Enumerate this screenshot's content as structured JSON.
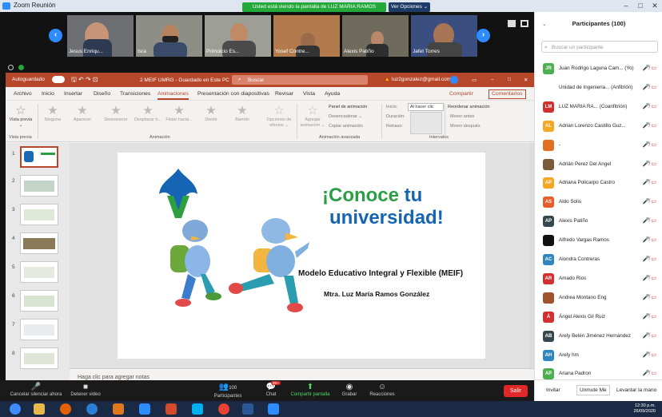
{
  "window": {
    "title": "Zoom Reunión"
  },
  "banner": {
    "share_text": "Usted está viendo la pantalla de LUZ MARIA RAMOS",
    "view_options": "Ver Opciones ⌄"
  },
  "video_tiles": [
    {
      "name": "Jesus Enriqu..."
    },
    {
      "name": "Isra"
    },
    {
      "name": "Primoicio Es..."
    },
    {
      "name": "Yosef Contre..."
    },
    {
      "name": "Alexis Patiño"
    },
    {
      "name": "Jafet Torres"
    }
  ],
  "ppt": {
    "autosave": "Autoguardado",
    "file": "2 MEIF UMRG - Guardado en Este PC ⌄",
    "search": "Buscar",
    "user": "luz2gonzalez@gmail.com",
    "tabs": [
      "Archivo",
      "Inicio",
      "Insertar",
      "Diseño",
      "Transiciones",
      "Animaciones",
      "Presentación con diapositivas",
      "Revisar",
      "Vista",
      "Ayuda"
    ],
    "active_tab": "Animaciones",
    "share": "Compartir",
    "comments": "Comentarios",
    "ribbon": {
      "vista_previa": "Vista previa ⌄",
      "vista_group": "Vista previa",
      "effects": [
        "Ninguna",
        "Aparecer",
        "Desvanecer",
        "Desplazar h...",
        "Flotar hacia...",
        "Dividir",
        "Barrido"
      ],
      "effect_options": "Opciones de efectos ⌄",
      "animation_group": "Animación",
      "add_animation": "Agregar animación ⌄",
      "panel": "Panel de animación",
      "trigger": "Desencadenar ⌄",
      "copy": "Copiar animación",
      "advanced_group": "Animación avanzada",
      "start_label": "Inicio:",
      "start_value": "Al hacer clic",
      "duration": "Duración:",
      "delay": "Retraso:",
      "timing_group": "Intervalos",
      "reorder": "Reordenar animación",
      "move_earlier": "Mover antes",
      "move_later": "Mover después"
    },
    "slides": [
      "1",
      "2",
      "3",
      "4",
      "5",
      "6",
      "7",
      "8"
    ],
    "notes": "Haga clic para agregar notas"
  },
  "slide": {
    "headline_1": "¡Conoce",
    "headline_tu": "tu",
    "headline_2": "universidad!",
    "title": "Modelo Educativo Integral y Flexible (MEIF)",
    "author": "Mtra. Luz María Ramos González"
  },
  "zoom_bar": {
    "mute": "Cancelar silenciar ahora",
    "video": "Detener video",
    "participants": "Participantes",
    "participants_count": "100",
    "chat": "Chat",
    "chat_badge": "99+",
    "share": "Compartir pantalla",
    "record": "Grabar",
    "reactions": "Reacciones",
    "leave": "Salir"
  },
  "participants": {
    "title": "Participantes (100)",
    "search_placeholder": "Buscar un participante",
    "list": [
      {
        "initials": "JR",
        "name": "Juan Rodrigo Laguna Cam... (Yo)",
        "color": "#4caf50"
      },
      {
        "initials": "",
        "name": "Unidad de Ingenieria... (Anfitrión)",
        "color": "#ffffff"
      },
      {
        "initials": "LM",
        "name": "LUZ MARIA RA... (Coanfitrión)",
        "color": "#d32f2f"
      },
      {
        "initials": "AL",
        "name": "Adrian Lorenzo Castillo Guz...",
        "color": "#f5a623"
      },
      {
        "initials": "",
        "name": "-",
        "color": "#e07020"
      },
      {
        "initials": "",
        "name": "Adrián Perez Del Angel",
        "color": "#7a5c3a"
      },
      {
        "initials": "AP",
        "name": "Adriana Policarpo Castro",
        "color": "#f5a623"
      },
      {
        "initials": "AS",
        "name": "Aldo Solis",
        "color": "#e85d2a"
      },
      {
        "initials": "AP",
        "name": "Alexis Patiño",
        "color": "#37474f"
      },
      {
        "initials": "",
        "name": "Alfredo Vargas Ramos",
        "color": "#111111"
      },
      {
        "initials": "AC",
        "name": "Alondra Contreras",
        "color": "#2e86c1"
      },
      {
        "initials": "AR",
        "name": "Amado Rios",
        "color": "#d32f2f"
      },
      {
        "initials": "",
        "name": "Andrea Montano Eng",
        "color": "#a0522d"
      },
      {
        "initials": "Á",
        "name": "Ángel Alexis Gil Ruiz",
        "color": "#d32f2f"
      },
      {
        "initials": "AB",
        "name": "Arely Belén Jiménez Hernández",
        "color": "#37474f"
      },
      {
        "initials": "AH",
        "name": "Arely hm",
        "color": "#2e86c1"
      },
      {
        "initials": "AP",
        "name": "Ariana Padron",
        "color": "#4caf50"
      }
    ],
    "invite": "Invitar",
    "unmute": "Unmute Me",
    "raise_hand": "Levantar la mano"
  },
  "taskbar": {
    "time": "12:30 p.m.",
    "date": "26/09/2020"
  }
}
